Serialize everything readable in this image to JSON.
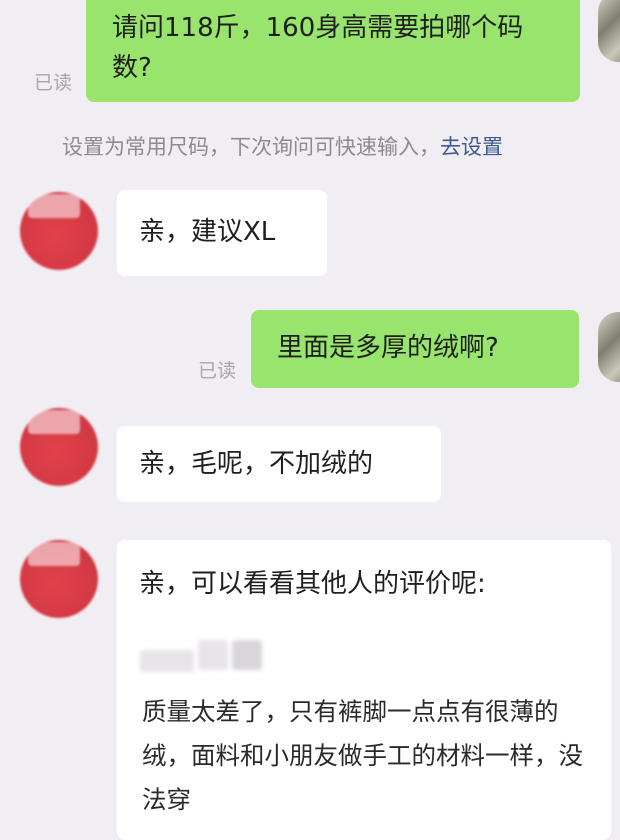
{
  "chat": {
    "messages": [
      {
        "side": "out",
        "text": "请问118斤，160身高需要拍哪个码数?",
        "status": "已读"
      },
      {
        "side": "in",
        "text": "亲，建议XL"
      },
      {
        "side": "out",
        "text": "里面是多厚的绒啊?",
        "status": "已读"
      },
      {
        "side": "in",
        "text": "亲，毛呢，不加绒的"
      },
      {
        "side": "in",
        "text": "亲，可以看看其他人的评价呢:"
      }
    ],
    "hint": {
      "text": "设置为常用尺码，下次询问可快速输入，",
      "link": "去设置"
    },
    "review": {
      "text": "质量太差了，只有裤脚一点点有很薄的绒，面料和小朋友做手工的材料一样，没法穿"
    }
  },
  "colors": {
    "outgoing_bubble": "#98e46d",
    "incoming_bubble": "#ffffff",
    "background": "#f1eef3",
    "link": "#3d5b8c"
  }
}
